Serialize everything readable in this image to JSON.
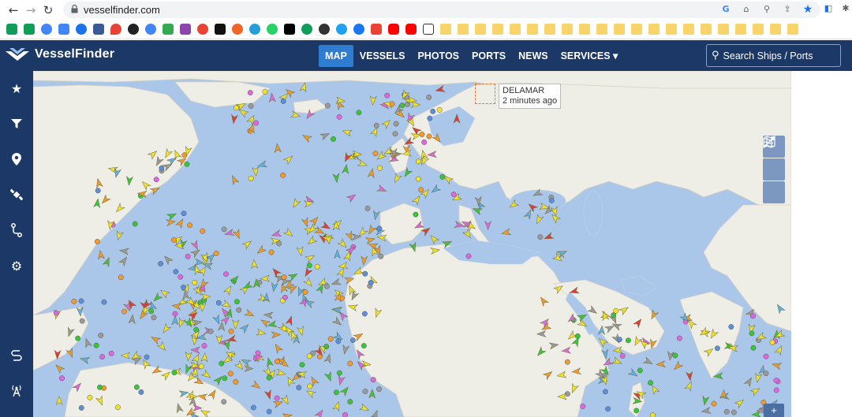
{
  "browser": {
    "url": "vesselfinder.com",
    "nav": {
      "back": "←",
      "forward": "→",
      "reload": "↻"
    }
  },
  "header": {
    "logo_text": "VesselFinder",
    "nav_items": [
      "MAP",
      "VESSELS",
      "PHOTOS",
      "PORTS",
      "NEWS",
      "SERVICES ▾"
    ],
    "active_nav": "MAP",
    "search_placeholder": "Search Ships  /  Ports",
    "brand_color": "#1b3866",
    "accent_color": "#2e7dd1"
  },
  "sidebar": {
    "items": [
      {
        "icon": "star-icon",
        "glyph": "★"
      },
      {
        "icon": "filter-icon",
        "glyph": "▼"
      },
      {
        "icon": "location-pin-icon",
        "glyph": "⚲"
      },
      {
        "icon": "satellite-icon",
        "glyph": "✈"
      },
      {
        "icon": "route-icon",
        "glyph": "⚯"
      },
      {
        "icon": "gear-icon",
        "glyph": "⚙"
      }
    ],
    "bottom_items": [
      {
        "icon": "path-icon",
        "glyph": "S"
      },
      {
        "icon": "antenna-icon",
        "glyph": "♆"
      }
    ]
  },
  "map": {
    "tooltip": {
      "vessel_name": "DELAMAR",
      "time": "2 minutes ago"
    },
    "tools": [
      {
        "icon": "map-layers-icon",
        "glyph": "▦"
      },
      {
        "icon": "weather-icon",
        "glyph": "≋"
      },
      {
        "icon": "measure-icon",
        "glyph": "⟋"
      }
    ],
    "zoom_in": "+",
    "colors": {
      "sea": "#aac6e8",
      "land": "#efeee6"
    }
  }
}
